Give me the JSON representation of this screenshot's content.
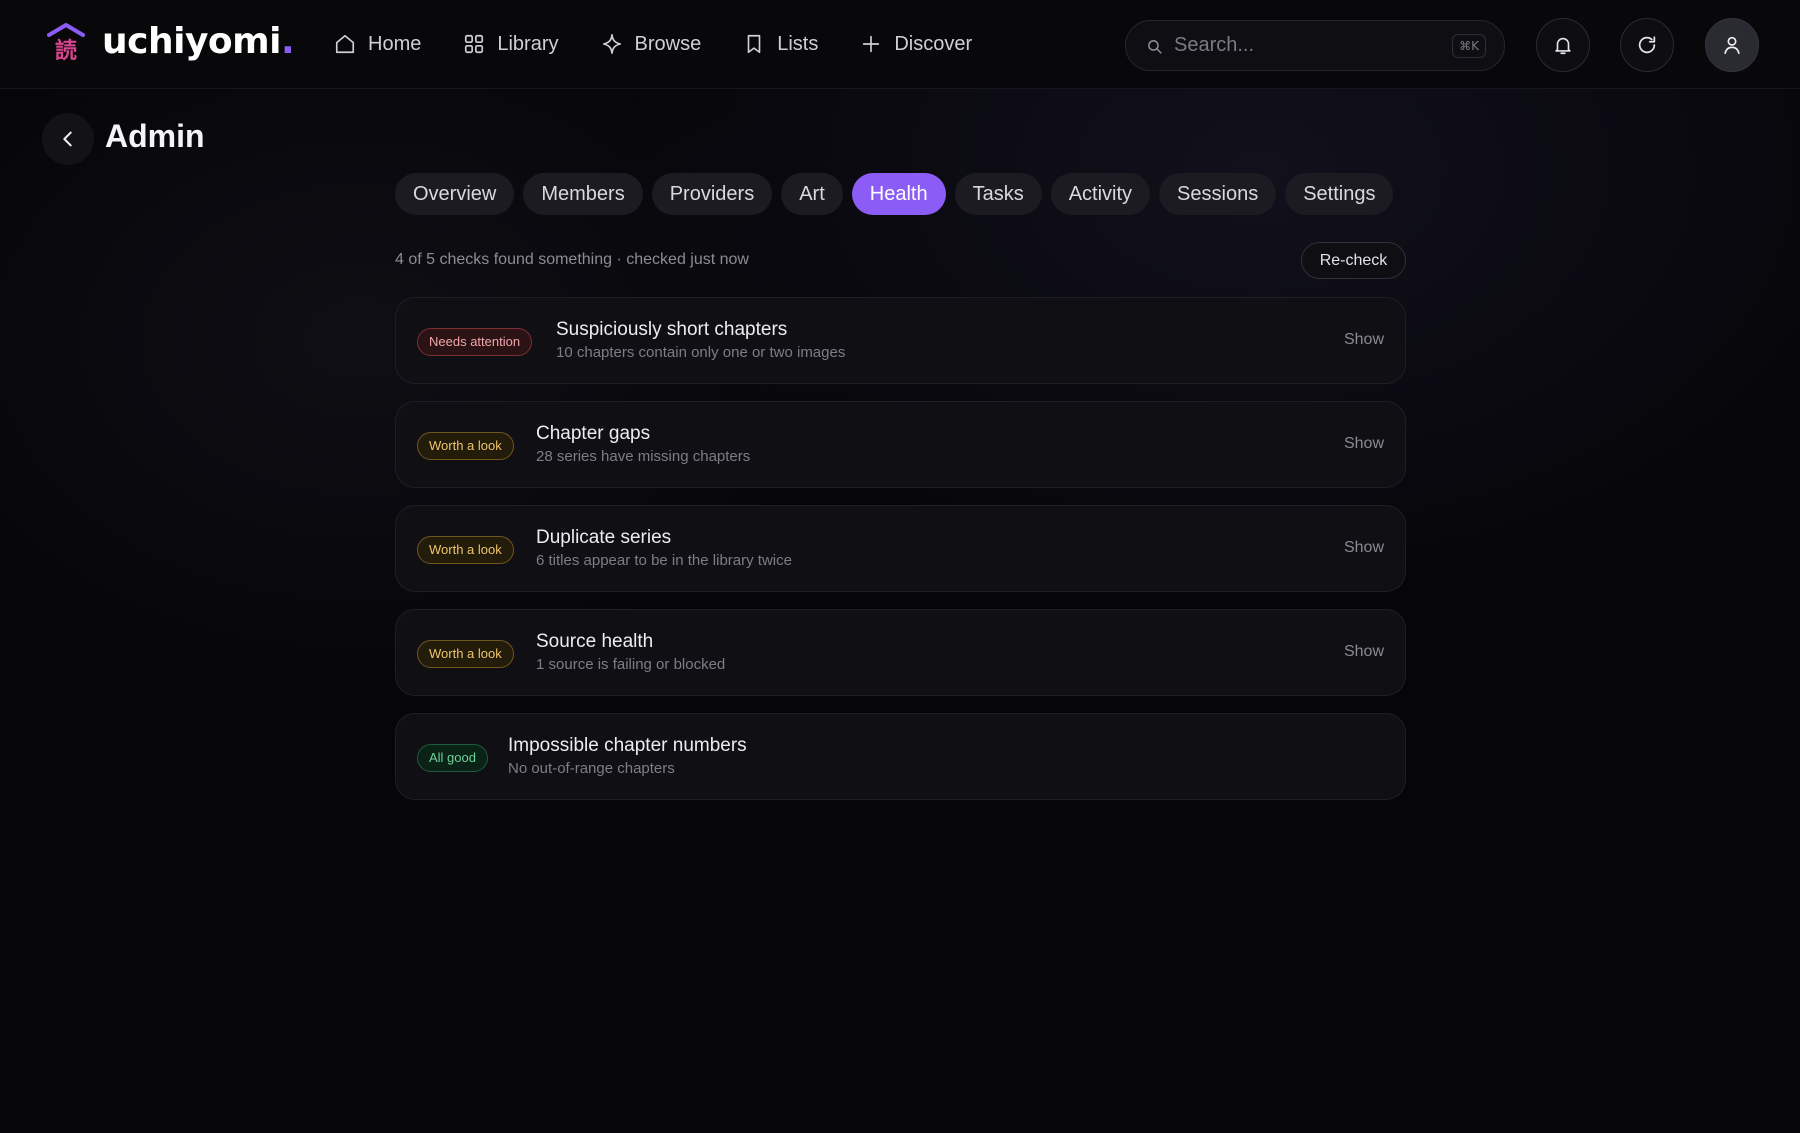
{
  "brand": {
    "name": "uchiyomi",
    "dot": ".",
    "mark_glyph": "読",
    "accent": "#8b5cf6"
  },
  "nav": {
    "items": [
      {
        "label": "Home",
        "icon": "home-icon"
      },
      {
        "label": "Library",
        "icon": "grid-icon"
      },
      {
        "label": "Browse",
        "icon": "sparkle-icon"
      },
      {
        "label": "Lists",
        "icon": "bookmark-icon"
      },
      {
        "label": "Discover",
        "icon": "plus-icon"
      }
    ]
  },
  "search": {
    "placeholder": "Search...",
    "shortcut": "⌘K"
  },
  "page": {
    "title": "Admin"
  },
  "tabs": [
    {
      "label": "Overview",
      "active": false
    },
    {
      "label": "Members",
      "active": false
    },
    {
      "label": "Providers",
      "active": false
    },
    {
      "label": "Art",
      "active": false
    },
    {
      "label": "Health",
      "active": true
    },
    {
      "label": "Tasks",
      "active": false
    },
    {
      "label": "Activity",
      "active": false
    },
    {
      "label": "Sessions",
      "active": false
    },
    {
      "label": "Settings",
      "active": false
    }
  ],
  "health": {
    "summary": "4 of 5 checks found something · checked just now",
    "recheck_label": "Re-check",
    "show_label": "Show",
    "checks": [
      {
        "status": "Needs attention",
        "level": "attention",
        "title": "Suspiciously short chapters",
        "subtitle": "10 chapters contain only one or two images",
        "has_show": true
      },
      {
        "status": "Worth a look",
        "level": "look",
        "title": "Chapter gaps",
        "subtitle": "28 series have missing chapters",
        "has_show": true
      },
      {
        "status": "Worth a look",
        "level": "look",
        "title": "Duplicate series",
        "subtitle": "6 titles appear to be in the library twice",
        "has_show": true
      },
      {
        "status": "Worth a look",
        "level": "look",
        "title": "Source health",
        "subtitle": "1 source is failing or blocked",
        "has_show": true
      },
      {
        "status": "All good",
        "level": "good",
        "title": "Impossible chapter numbers",
        "subtitle": "No out-of-range chapters",
        "has_show": false
      }
    ]
  },
  "colors": {
    "attention": "#f0a7a9",
    "look": "#ecc56a",
    "good": "#6fd49a"
  }
}
